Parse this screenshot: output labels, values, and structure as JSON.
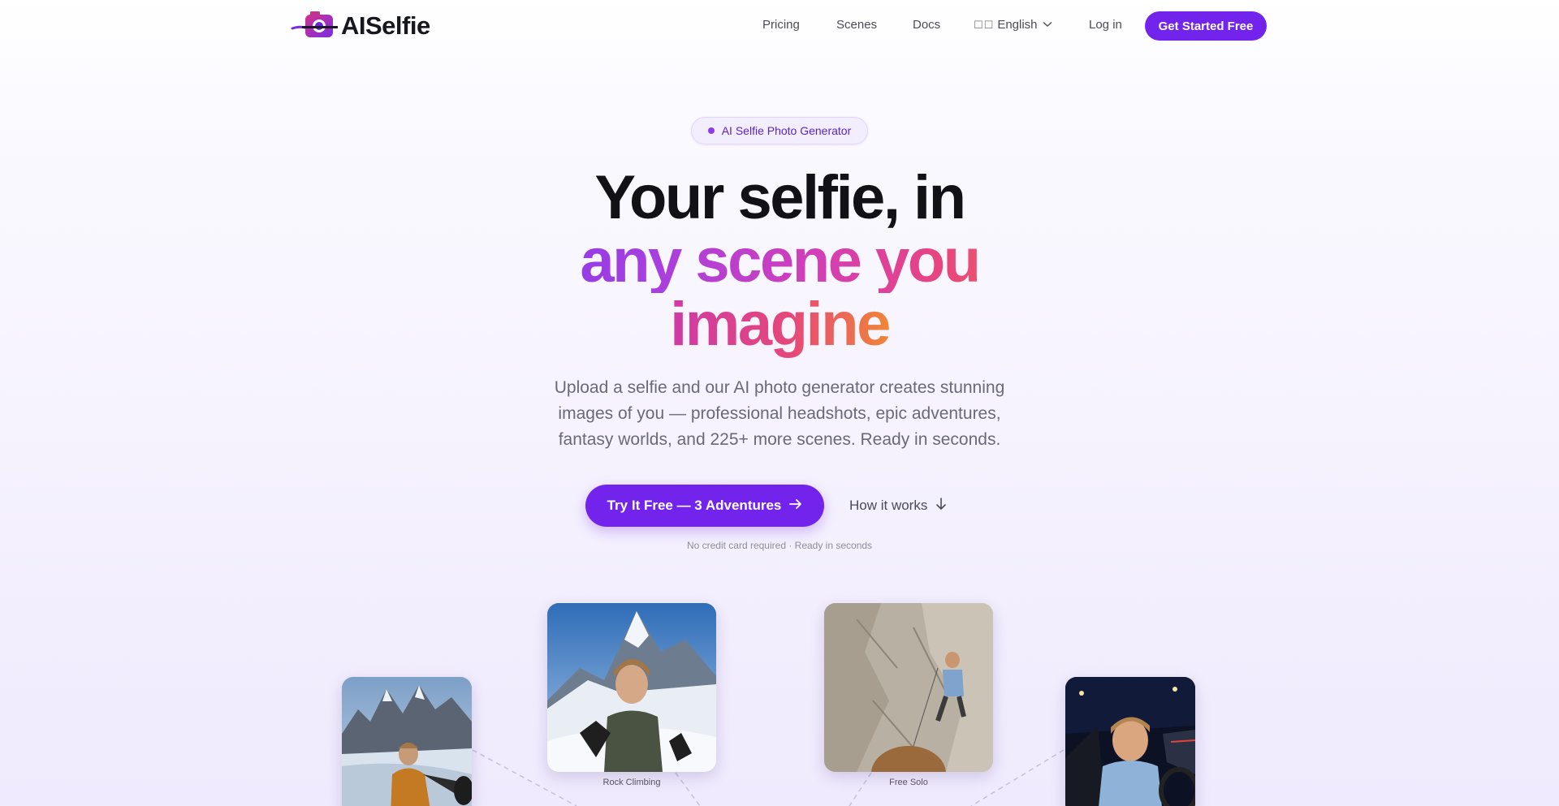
{
  "nav": {
    "logo_text": "AISelfie",
    "links": [
      "Pricing",
      "Scenes",
      "Docs"
    ],
    "language_flag": "☐☐",
    "language": "English",
    "login": "Log in",
    "cta": "Get Started Free"
  },
  "hero": {
    "badge": "AI Selfie Photo Generator",
    "headline_line1": "Your selfie, in",
    "headline_line2": "any scene you",
    "headline_line3": "imagine",
    "subtitle": "Upload a selfie and our AI photo generator creates stunning images of you — professional headshots, epic adventures, fantasy worlds, and 225+ more scenes. Ready in seconds.",
    "primary_button": "Try It Free — 3 Adventures",
    "secondary_button": "How it works",
    "note": "No credit card required · Ready in seconds"
  },
  "gallery": {
    "captions": [
      "Rock Climbing",
      "Free Solo"
    ]
  },
  "colors": {
    "brand_purple": "#7224ec",
    "gradient_start": "#7b36ee",
    "gradient_mid": "#d13fb9",
    "gradient_end": "#f07d3c"
  }
}
